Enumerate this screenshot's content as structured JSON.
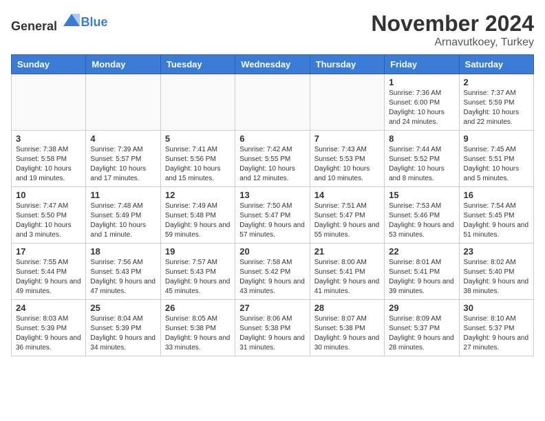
{
  "header": {
    "logo_general": "General",
    "logo_blue": "Blue",
    "month": "November 2024",
    "location": "Arnavutkoey, Turkey"
  },
  "weekdays": [
    "Sunday",
    "Monday",
    "Tuesday",
    "Wednesday",
    "Thursday",
    "Friday",
    "Saturday"
  ],
  "weeks": [
    [
      {
        "day": "",
        "info": ""
      },
      {
        "day": "",
        "info": ""
      },
      {
        "day": "",
        "info": ""
      },
      {
        "day": "",
        "info": ""
      },
      {
        "day": "",
        "info": ""
      },
      {
        "day": "1",
        "info": "Sunrise: 7:36 AM\nSunset: 6:00 PM\nDaylight: 10 hours and 24 minutes."
      },
      {
        "day": "2",
        "info": "Sunrise: 7:37 AM\nSunset: 5:59 PM\nDaylight: 10 hours and 22 minutes."
      }
    ],
    [
      {
        "day": "3",
        "info": "Sunrise: 7:38 AM\nSunset: 5:58 PM\nDaylight: 10 hours and 19 minutes."
      },
      {
        "day": "4",
        "info": "Sunrise: 7:39 AM\nSunset: 5:57 PM\nDaylight: 10 hours and 17 minutes."
      },
      {
        "day": "5",
        "info": "Sunrise: 7:41 AM\nSunset: 5:56 PM\nDaylight: 10 hours and 15 minutes."
      },
      {
        "day": "6",
        "info": "Sunrise: 7:42 AM\nSunset: 5:55 PM\nDaylight: 10 hours and 12 minutes."
      },
      {
        "day": "7",
        "info": "Sunrise: 7:43 AM\nSunset: 5:53 PM\nDaylight: 10 hours and 10 minutes."
      },
      {
        "day": "8",
        "info": "Sunrise: 7:44 AM\nSunset: 5:52 PM\nDaylight: 10 hours and 8 minutes."
      },
      {
        "day": "9",
        "info": "Sunrise: 7:45 AM\nSunset: 5:51 PM\nDaylight: 10 hours and 5 minutes."
      }
    ],
    [
      {
        "day": "10",
        "info": "Sunrise: 7:47 AM\nSunset: 5:50 PM\nDaylight: 10 hours and 3 minutes."
      },
      {
        "day": "11",
        "info": "Sunrise: 7:48 AM\nSunset: 5:49 PM\nDaylight: 10 hours and 1 minute."
      },
      {
        "day": "12",
        "info": "Sunrise: 7:49 AM\nSunset: 5:48 PM\nDaylight: 9 hours and 59 minutes."
      },
      {
        "day": "13",
        "info": "Sunrise: 7:50 AM\nSunset: 5:47 PM\nDaylight: 9 hours and 57 minutes."
      },
      {
        "day": "14",
        "info": "Sunrise: 7:51 AM\nSunset: 5:47 PM\nDaylight: 9 hours and 55 minutes."
      },
      {
        "day": "15",
        "info": "Sunrise: 7:53 AM\nSunset: 5:46 PM\nDaylight: 9 hours and 53 minutes."
      },
      {
        "day": "16",
        "info": "Sunrise: 7:54 AM\nSunset: 5:45 PM\nDaylight: 9 hours and 51 minutes."
      }
    ],
    [
      {
        "day": "17",
        "info": "Sunrise: 7:55 AM\nSunset: 5:44 PM\nDaylight: 9 hours and 49 minutes."
      },
      {
        "day": "18",
        "info": "Sunrise: 7:56 AM\nSunset: 5:43 PM\nDaylight: 9 hours and 47 minutes."
      },
      {
        "day": "19",
        "info": "Sunrise: 7:57 AM\nSunset: 5:43 PM\nDaylight: 9 hours and 45 minutes."
      },
      {
        "day": "20",
        "info": "Sunrise: 7:58 AM\nSunset: 5:42 PM\nDaylight: 9 hours and 43 minutes."
      },
      {
        "day": "21",
        "info": "Sunrise: 8:00 AM\nSunset: 5:41 PM\nDaylight: 9 hours and 41 minutes."
      },
      {
        "day": "22",
        "info": "Sunrise: 8:01 AM\nSunset: 5:41 PM\nDaylight: 9 hours and 39 minutes."
      },
      {
        "day": "23",
        "info": "Sunrise: 8:02 AM\nSunset: 5:40 PM\nDaylight: 9 hours and 38 minutes."
      }
    ],
    [
      {
        "day": "24",
        "info": "Sunrise: 8:03 AM\nSunset: 5:39 PM\nDaylight: 9 hours and 36 minutes."
      },
      {
        "day": "25",
        "info": "Sunrise: 8:04 AM\nSunset: 5:39 PM\nDaylight: 9 hours and 34 minutes."
      },
      {
        "day": "26",
        "info": "Sunrise: 8:05 AM\nSunset: 5:38 PM\nDaylight: 9 hours and 33 minutes."
      },
      {
        "day": "27",
        "info": "Sunrise: 8:06 AM\nSunset: 5:38 PM\nDaylight: 9 hours and 31 minutes."
      },
      {
        "day": "28",
        "info": "Sunrise: 8:07 AM\nSunset: 5:38 PM\nDaylight: 9 hours and 30 minutes."
      },
      {
        "day": "29",
        "info": "Sunrise: 8:09 AM\nSunset: 5:37 PM\nDaylight: 9 hours and 28 minutes."
      },
      {
        "day": "30",
        "info": "Sunrise: 8:10 AM\nSunset: 5:37 PM\nDaylight: 9 hours and 27 minutes."
      }
    ]
  ]
}
